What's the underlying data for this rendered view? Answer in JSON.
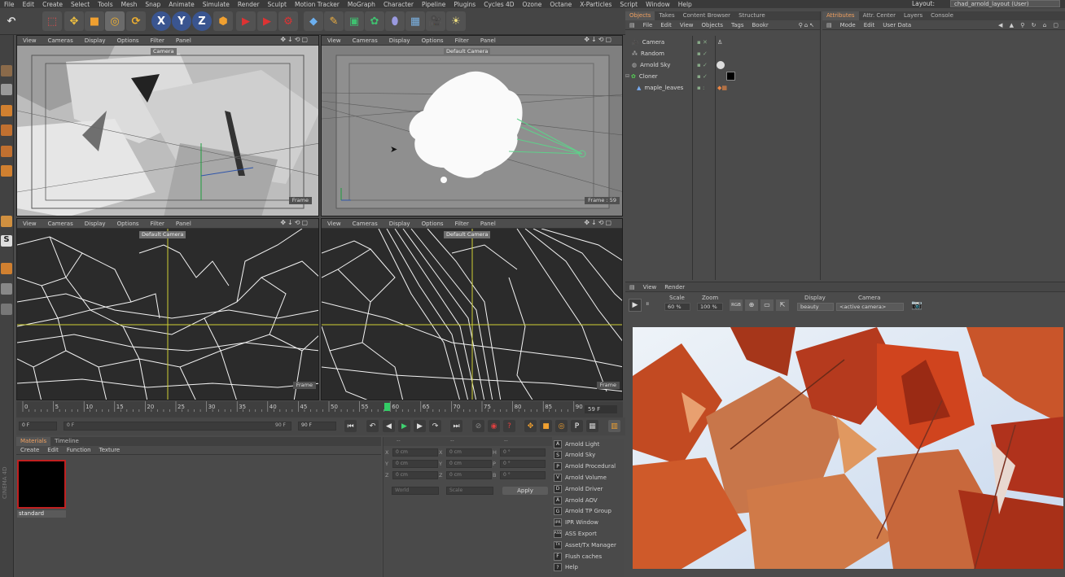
{
  "menubar": {
    "items": [
      "File",
      "Edit",
      "Create",
      "Select",
      "Tools",
      "Mesh",
      "Snap",
      "Animate",
      "Simulate",
      "Render",
      "Sculpt",
      "Motion Tracker",
      "MoGraph",
      "Character",
      "Pipeline",
      "Plugins",
      "Cycles 4D",
      "Ozone",
      "Octane",
      "X-Particles",
      "Script",
      "Window",
      "Help"
    ],
    "layout_label": "Layout:",
    "layout_value": "chad_arnold_layout (User)"
  },
  "viewport_menu": {
    "view": "View",
    "cameras": "Cameras",
    "display": "Display",
    "options": "Options",
    "filter": "Filter",
    "panel": "Panel"
  },
  "viewports": [
    {
      "camera_tag": "Camera",
      "frame_tag": "Frame"
    },
    {
      "camera_tag": "Default Camera",
      "frame_tag": "Frame : 59"
    },
    {
      "camera_tag": "Default Camera",
      "frame_tag": "Frame"
    },
    {
      "camera_tag": "Default Camera",
      "frame_tag": "Frame"
    }
  ],
  "timeline": {
    "ticks": [
      "0",
      "5",
      "10",
      "15",
      "20",
      "25",
      "30",
      "35",
      "40",
      "45",
      "50",
      "55",
      "60",
      "65",
      "70",
      "75",
      "80",
      "85",
      "90"
    ],
    "current_frame": "59",
    "current_readout": "59 F"
  },
  "transport": {
    "start_field": "0 F",
    "range_start": "0 F",
    "range_end": "90 F",
    "end_field": "90 F"
  },
  "materials": {
    "tabs": [
      "Materials",
      "Timeline"
    ],
    "menu": [
      "Create",
      "Edit",
      "Function",
      "Texture"
    ],
    "material_name": "standard"
  },
  "coordinates": {
    "header": [
      "--",
      "--",
      "--"
    ],
    "rows": [
      {
        "a": "X",
        "av": "0 cm",
        "b": "X",
        "bv": "0 cm",
        "c": "H",
        "cv": "0 °"
      },
      {
        "a": "Y",
        "av": "0 cm",
        "b": "Y",
        "bv": "0 cm",
        "c": "P",
        "cv": "0 °"
      },
      {
        "a": "Z",
        "av": "0 cm",
        "b": "Z",
        "bv": "0 cm",
        "c": "B",
        "cv": "0 °"
      }
    ],
    "mode_world": "World",
    "mode_scale": "Scale",
    "apply": "Apply"
  },
  "arnold_menu": [
    {
      "icon": "A",
      "label": "Arnold Light"
    },
    {
      "icon": "S",
      "label": "Arnold Sky"
    },
    {
      "icon": "P",
      "label": "Arnold Procedural"
    },
    {
      "icon": "V",
      "label": "Arnold Volume"
    },
    {
      "icon": "D",
      "label": "Arnold Driver"
    },
    {
      "icon": "A",
      "label": "Arnold AOV"
    },
    {
      "icon": "G",
      "label": "Arnold TP Group"
    },
    {
      "icon": "IPR",
      "label": "IPR Window"
    },
    {
      "icon": "ASS",
      "label": "ASS Export"
    },
    {
      "icon": "TX",
      "label": "Asset/Tx Manager"
    },
    {
      "icon": "F",
      "label": "Flush caches"
    },
    {
      "icon": "?",
      "label": "Help"
    }
  ],
  "objects_panel": {
    "tabs": [
      "Objects",
      "Takes",
      "Content Browser",
      "Structure"
    ],
    "menu": [
      "File",
      "Edit",
      "View",
      "Objects",
      "Tags",
      "Bookr"
    ],
    "items": [
      "Camera",
      "Random",
      "Arnold Sky",
      "Cloner",
      "maple_leaves"
    ]
  },
  "attributes_panel": {
    "tabs": [
      "Attributes",
      "Attr. Center",
      "Layers",
      "Console"
    ],
    "menu": [
      "Mode",
      "Edit",
      "User Data"
    ]
  },
  "ipr": {
    "menu": [
      "View",
      "Render"
    ],
    "scale_label": "Scale",
    "scale_value": "60 %",
    "zoom_label": "Zoom",
    "zoom_value": "100 %",
    "display_label": "Display",
    "display_value": "beauty",
    "camera_label": "Camera",
    "camera_value": "<active camera>"
  },
  "cinema_logo": "CINEMA 4D",
  "colors": {
    "accent": "#e8a050",
    "timeline_marker": "#33cc66",
    "ipr_sky": "#dfe8f3",
    "leaf_red": "#b53a1e"
  }
}
